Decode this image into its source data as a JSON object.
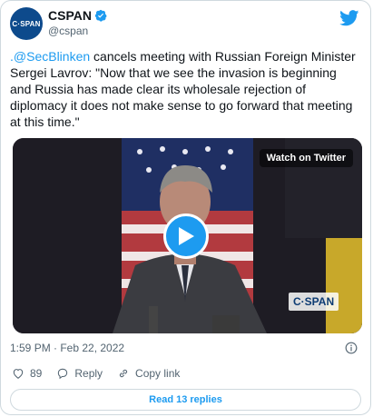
{
  "author": {
    "avatar_text": "C·SPAN",
    "display_name": "CSPAN",
    "handle": "@cspan"
  },
  "tweet": {
    "mention": ".@SecBlinken",
    "body": " cancels meeting with Russian Foreign Minister Sergei Lavrov: \"Now that we see the invasion is beginning and Russia has made clear its wholesale rejection of diplomacy it does not make sense to go forward that meeting at this time.\"",
    "timestamp": "1:59 PM · Feb 22, 2022"
  },
  "media": {
    "watch_label": "Watch on Twitter",
    "watermark": "C·SPAN"
  },
  "actions": {
    "likes": "89",
    "reply_label": "Reply",
    "copy_label": "Copy link"
  },
  "footer": {
    "read_replies": "Read 13 replies"
  },
  "colors": {
    "accent": "#1d9bf0",
    "secondary_text": "#536471",
    "border": "#cfd9de"
  },
  "icons": [
    "verified-badge-icon",
    "twitter-bird-icon",
    "play-icon",
    "info-icon",
    "heart-icon",
    "reply-icon",
    "link-icon"
  ]
}
